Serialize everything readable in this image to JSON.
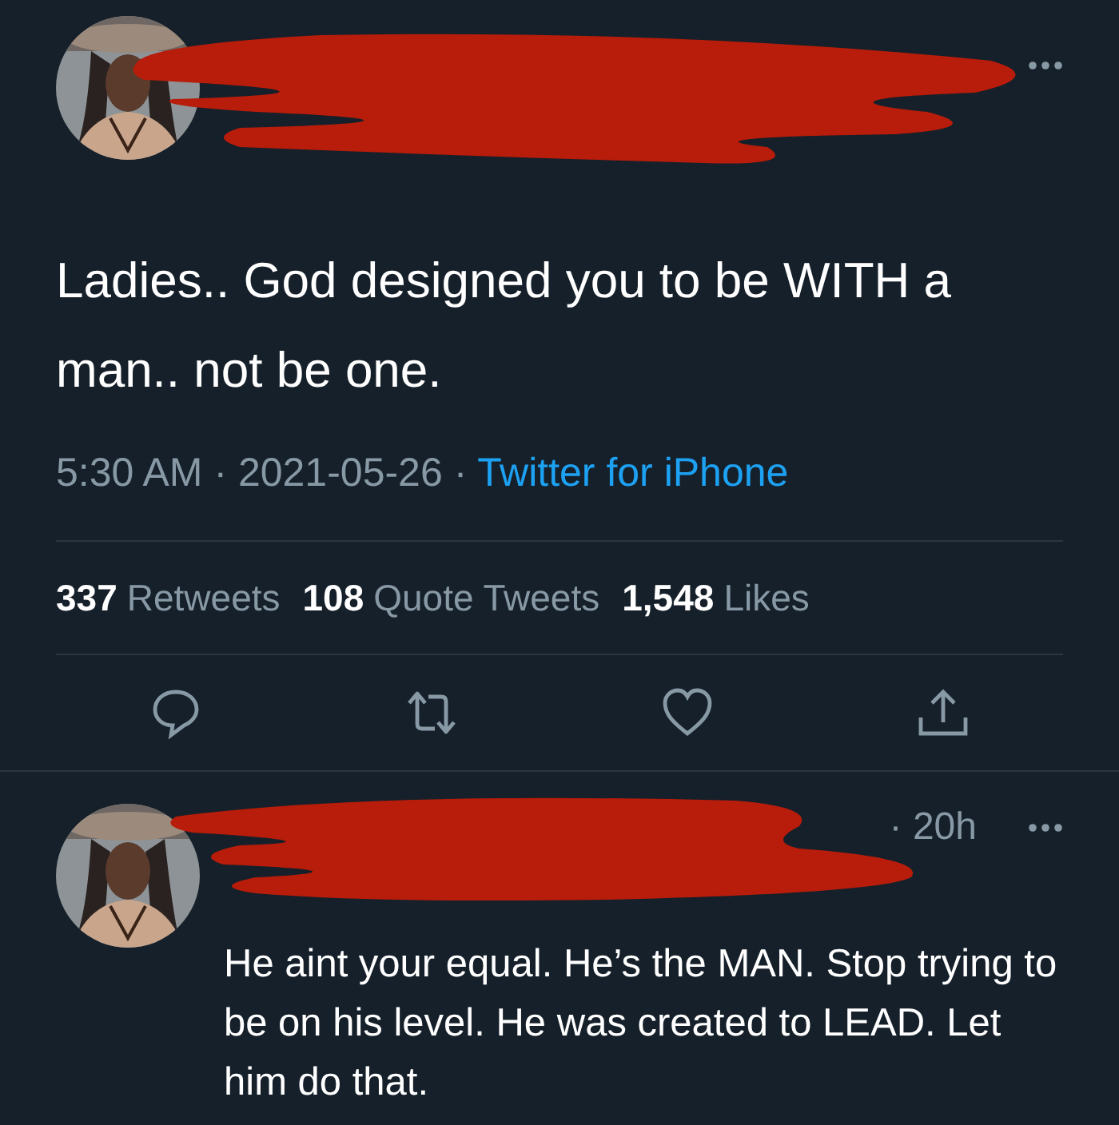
{
  "tweet": {
    "text": "Ladies.. God designed you to be WITH a man.. not be one.",
    "meta": {
      "time": "5:30 AM",
      "separator": "·",
      "date": "2021-05-26",
      "source": "Twitter for iPhone"
    },
    "stats": [
      {
        "count": "337",
        "label": "Retweets"
      },
      {
        "count": "108",
        "label": "Quote Tweets"
      },
      {
        "count": "1,548",
        "label": "Likes"
      }
    ]
  },
  "reply": {
    "age": "· 20h",
    "text": "He aint your equal. He’s the MAN. Stop trying to be on his level. He was created to LEAD. Let him do that."
  }
}
